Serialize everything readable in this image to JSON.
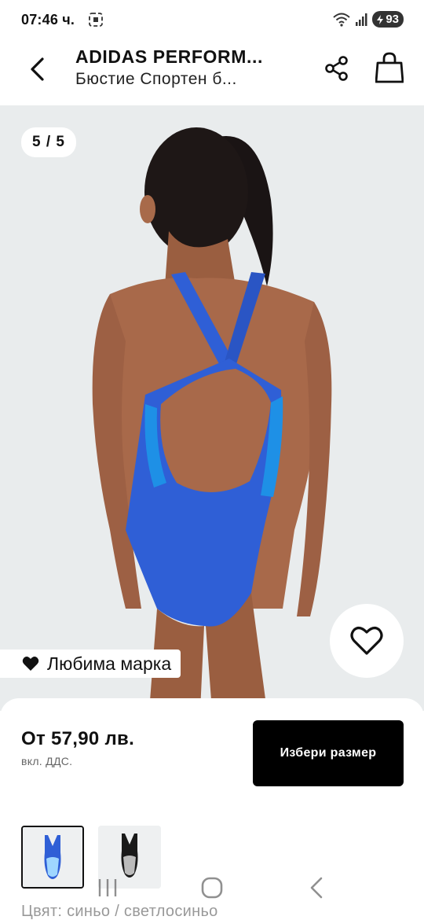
{
  "status_bar": {
    "time": "07:46 ч.",
    "battery": "93"
  },
  "header": {
    "brand": "ADIDAS PERFORM...",
    "product_name": "Бюстие Спортен б..."
  },
  "gallery": {
    "counter": "5 / 5",
    "favorite_brand_label": "Любима марка"
  },
  "purchase": {
    "price": "От 57,90 лв.",
    "vat_note": "вкл. ДДС.",
    "select_size_label": "Избери размер"
  },
  "variants": {
    "color_label": "Цвят: синьо / светлосиньо"
  },
  "colors": {
    "accent_button": "#000000",
    "swimsuit_blue": "#2f5fd6",
    "image_background": "#e9eced"
  },
  "icons": [
    "back-icon",
    "share-icon",
    "shopping-bag-icon",
    "heart-outline-icon",
    "heart-filled-icon",
    "nav-recents-icon",
    "nav-home-icon",
    "nav-back-icon"
  ]
}
